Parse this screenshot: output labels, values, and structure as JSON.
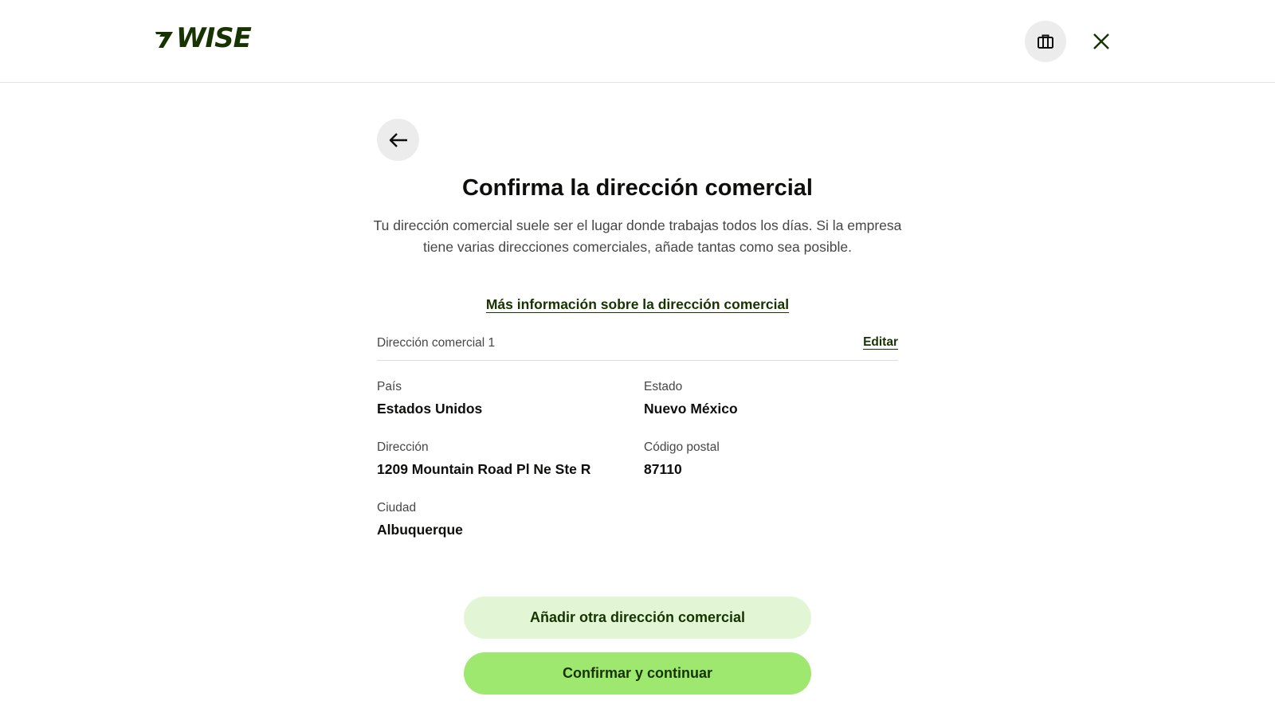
{
  "header": {
    "logo_text": "WISE",
    "business_icon": "briefcase-icon",
    "close_icon": "close-icon"
  },
  "nav": {
    "back_icon": "arrow-left-icon"
  },
  "page": {
    "title": "Confirma la dirección comercial",
    "subtitle": "Tu dirección comercial suele ser el lugar donde trabajas todos los días. Si la empresa tiene varias direcciones comerciales, añade tantas como sea posible.",
    "info_link": "Más información sobre la dirección comercial"
  },
  "address": {
    "title": "Dirección comercial 1",
    "edit_label": "Editar",
    "fields": {
      "country": {
        "label": "País",
        "value": "Estados Unidos"
      },
      "state": {
        "label": "Estado",
        "value": "Nuevo México"
      },
      "street": {
        "label": "Dirección",
        "value": "1209 Mountain Road Pl Ne Ste R"
      },
      "postal": {
        "label": "Código postal",
        "value": "87110"
      },
      "city": {
        "label": "Ciudad",
        "value": "Albuquerque"
      }
    }
  },
  "actions": {
    "add_label": "Añadir otra dirección comercial",
    "confirm_label": "Confirmar y continuar"
  },
  "colors": {
    "brand_dark": "#163300",
    "brand_green": "#9fe870",
    "light_green": "#e2f6d5"
  }
}
